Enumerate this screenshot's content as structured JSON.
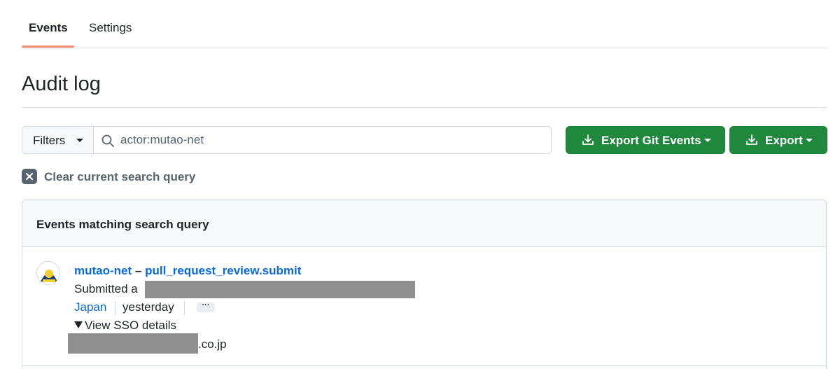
{
  "tabs": [
    {
      "label": "Events",
      "active": true
    },
    {
      "label": "Settings",
      "active": false
    }
  ],
  "page": {
    "title": "Audit log"
  },
  "search": {
    "filters_label": "Filters",
    "value": "actor:mutao-net"
  },
  "buttons": {
    "export_git": "Export Git Events",
    "export": "Export"
  },
  "clear": {
    "label": "Clear current search query"
  },
  "results": {
    "title": "Events matching search query",
    "event": {
      "actor": "mutao-net",
      "separator": "–",
      "action": "pull_request_review.submit",
      "description": "Submitted a",
      "location": "Japan",
      "time": "yesterday",
      "more": "···",
      "sso_toggle": "View SSO details",
      "sso_domain_suffix": ".co.jp"
    }
  },
  "colors": {
    "accent_underline": "#fd8c73",
    "primary_button": "#1f883d",
    "link": "#0969da",
    "redaction": "#8f8f8f"
  },
  "icons": [
    "search-icon",
    "download-icon",
    "close-icon",
    "chevron-down-icon",
    "triangle-down-icon"
  ]
}
